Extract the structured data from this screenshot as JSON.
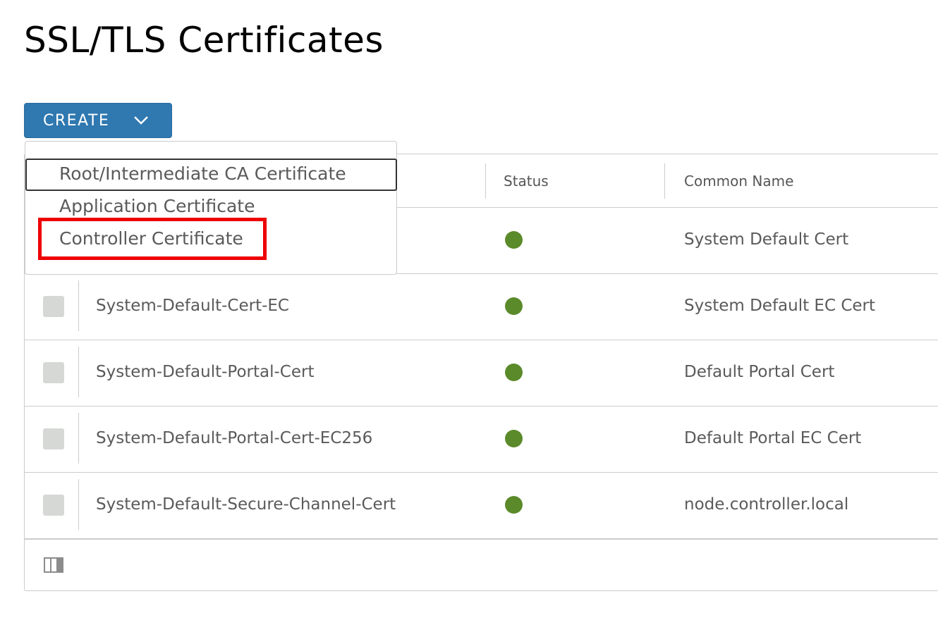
{
  "page": {
    "title": "SSL/TLS Certificates"
  },
  "toolbar": {
    "create_label": "CREATE",
    "create_icon": "chevron-down-icon"
  },
  "dropdown": {
    "items": [
      {
        "label": "Root/Intermediate CA Certificate",
        "focused": true
      },
      {
        "label": "Application Certificate"
      },
      {
        "label": "Controller Certificate",
        "highlighted": true
      }
    ]
  },
  "grid": {
    "columns": [
      "Status",
      "Common Name"
    ],
    "rows": [
      {
        "name": "",
        "status": "active",
        "common_name": "System Default Cert"
      },
      {
        "name": "System-Default-Cert-EC",
        "status": "active",
        "common_name": "System Default EC Cert"
      },
      {
        "name": "System-Default-Portal-Cert",
        "status": "active",
        "common_name": "Default Portal Cert"
      },
      {
        "name": "System-Default-Portal-Cert-EC256",
        "status": "active",
        "common_name": "Default Portal EC Cert"
      },
      {
        "name": "System-Default-Secure-Channel-Cert",
        "status": "active",
        "common_name": "node.controller.local"
      }
    ],
    "footer_icon": "column-toggle-icon"
  },
  "colors": {
    "primary_button": "#2f78b0",
    "status_ok": "#5b8a2a",
    "highlight": "#ee0000"
  }
}
